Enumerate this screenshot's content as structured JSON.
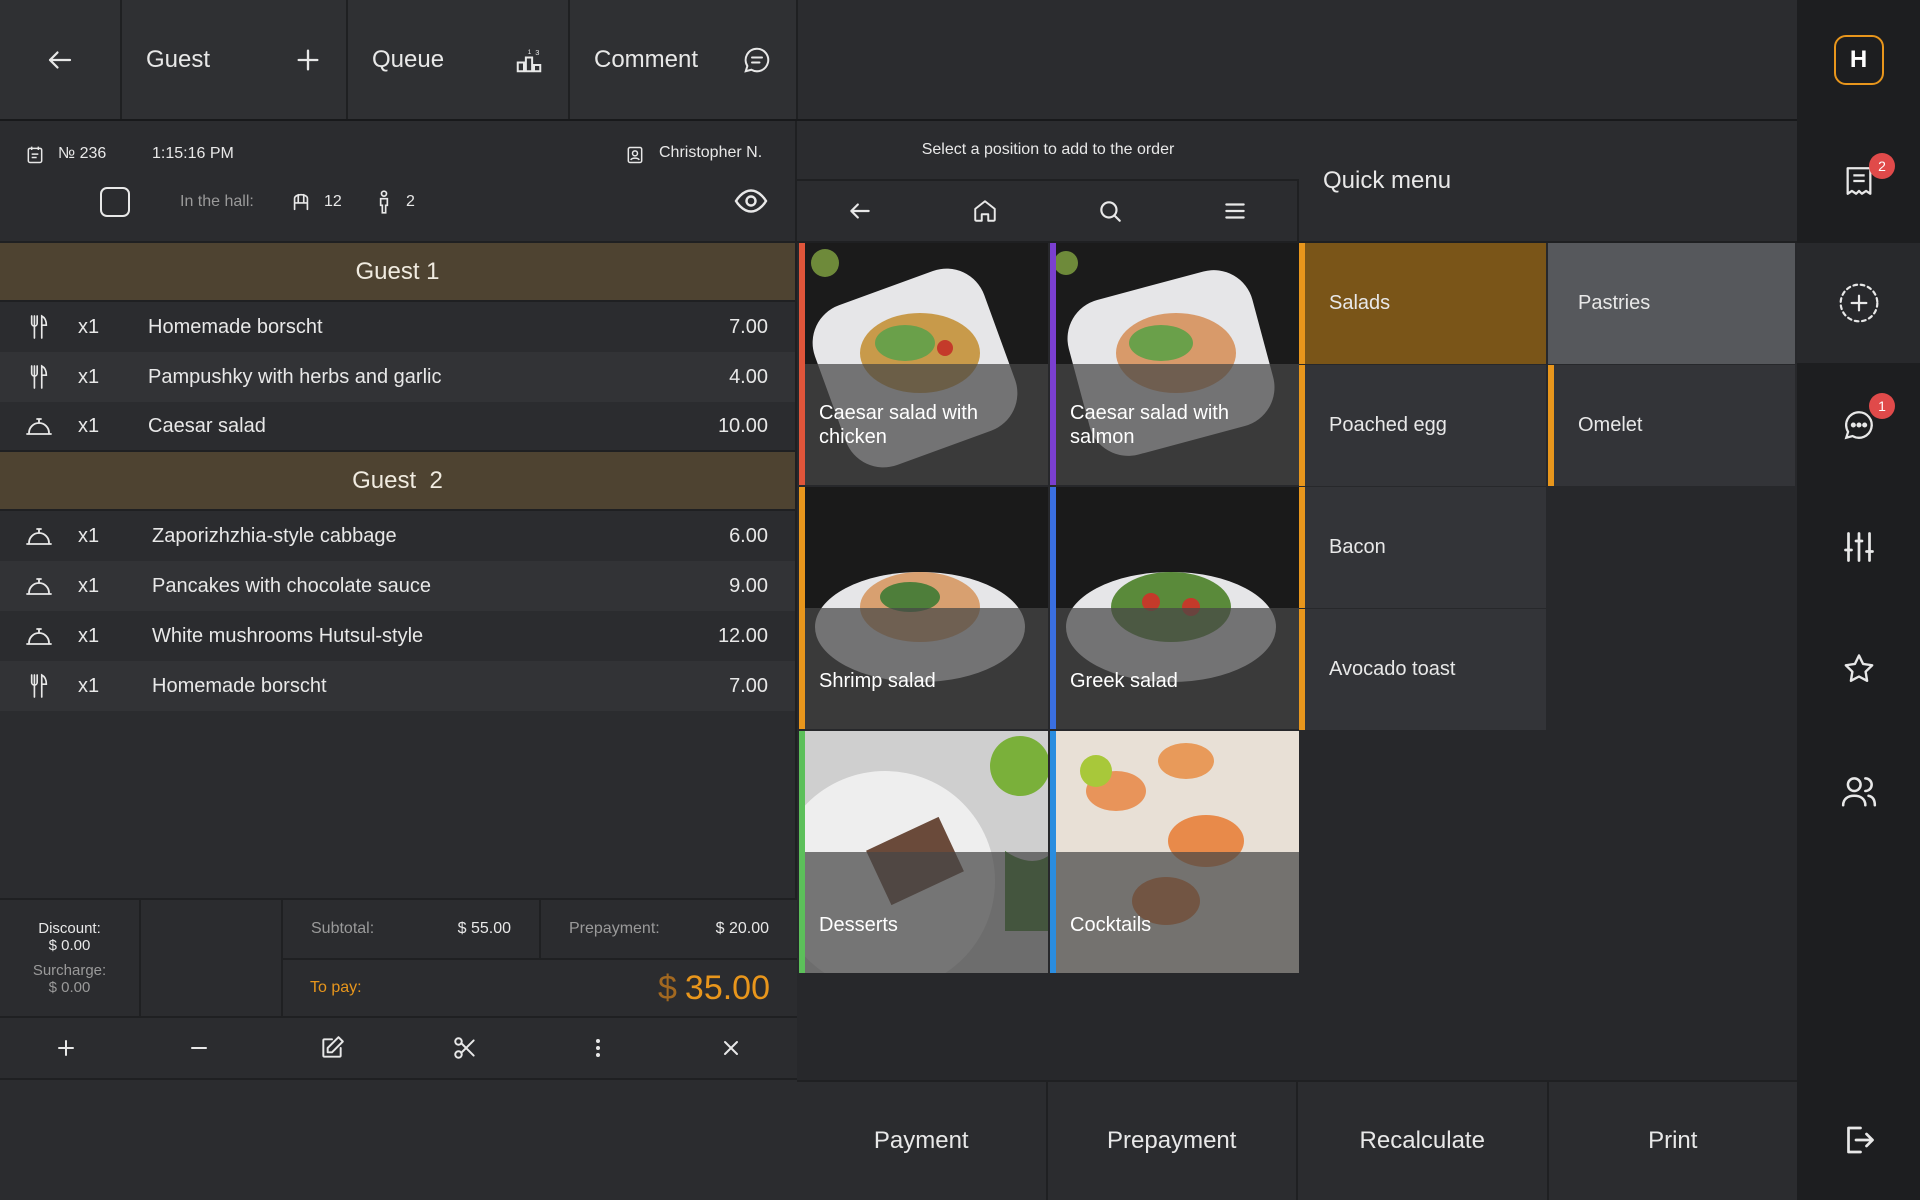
{
  "topbar": {
    "guest_label": "Guest",
    "queue_label": "Queue",
    "comment_label": "Comment"
  },
  "order": {
    "number": "№ 236",
    "time": "1:15:16 PM",
    "waiter": "Christopher N.",
    "hall_label": "In the hall:",
    "table_count": "12",
    "person_count": "2",
    "guests": [
      {
        "title": "Guest 1",
        "items": [
          {
            "icon": "fork-knife-icon",
            "qty": "x1",
            "name": "Homemade borscht",
            "price": "7.00"
          },
          {
            "icon": "fork-knife-icon",
            "qty": "x1",
            "name": "Pampushky with herbs and garlic",
            "price": "4.00"
          },
          {
            "icon": "cloche-icon",
            "qty": "x1",
            "name": "Caesar salad",
            "price": "10.00"
          }
        ]
      },
      {
        "title": "Guest  2",
        "items": [
          {
            "icon": "cloche-icon",
            "qty": "x1",
            "name": "Zaporizhzhia-style cabbage",
            "price": "6.00"
          },
          {
            "icon": "cloche-icon",
            "qty": "x1",
            "name": "Pancakes with chocolate sauce",
            "price": "9.00"
          },
          {
            "icon": "cloche-icon",
            "qty": "x1",
            "name": "White mushrooms Hutsul-style",
            "price": "12.00"
          },
          {
            "icon": "fork-knife-icon",
            "qty": "x1",
            "name": "Homemade borscht",
            "price": "7.00"
          }
        ]
      }
    ],
    "totals": {
      "discount_label": "Discount:",
      "discount_value": "$ 0.00",
      "surcharge_label": "Surcharge:",
      "surcharge_value": "$ 0.00",
      "subtotal_label": "Subtotal:",
      "subtotal_value": "$ 55.00",
      "prepayment_label": "Prepayment:",
      "prepayment_value": "$ 20.00",
      "topay_label": "To pay:",
      "topay_currency": "$",
      "topay_value": "35.00"
    }
  },
  "menu": {
    "hint": "Select a position to add to the order",
    "tiles": [
      {
        "label": "Caesar salad with chicken",
        "accent": "#e0553a"
      },
      {
        "label": "Caesar salad with salmon",
        "accent": "#7b3fd0"
      },
      {
        "label": "Shrimp salad",
        "accent": "#e8961c"
      },
      {
        "label": "Greek salad",
        "accent": "#3a6fe0"
      },
      {
        "label": "Desserts",
        "accent": "#5cc05a"
      },
      {
        "label": "Cocktails",
        "accent": "#2a8de0"
      }
    ]
  },
  "quick_menu": {
    "title": "Quick menu",
    "items": [
      "Salads",
      "Pastries",
      "Poached egg",
      "Omelet",
      "Bacon",
      "Avocado toast"
    ]
  },
  "bottom_buttons": [
    "Payment",
    "Prepayment",
    "Recalculate",
    "Print"
  ],
  "sidebar": {
    "logo": "H",
    "orders_badge": "2",
    "messages_badge": "1"
  },
  "colors": {
    "accent": "#e8961c",
    "guest_header": "#4e4331",
    "badge": "#e04a4a"
  }
}
